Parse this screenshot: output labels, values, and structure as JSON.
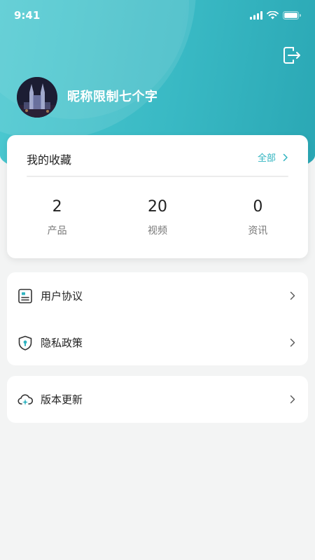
{
  "status_bar": {
    "time": "9:41"
  },
  "profile": {
    "nickname": "昵称限制七个字"
  },
  "favorites": {
    "title": "我的收藏",
    "all_label": "全部",
    "stats": [
      {
        "value": "2",
        "label": "产品"
      },
      {
        "value": "20",
        "label": "视频"
      },
      {
        "value": "0",
        "label": "资讯"
      }
    ]
  },
  "menu": {
    "group1": [
      {
        "label": "用户协议",
        "icon": "document-icon"
      },
      {
        "label": "隐私政策",
        "icon": "shield-icon"
      }
    ],
    "group2": [
      {
        "label": "版本更新",
        "icon": "cloud-update-icon"
      }
    ]
  },
  "colors": {
    "accent": "#2fb3c0",
    "header_start": "#4cc9d1",
    "header_end": "#2aa7b4",
    "background": "#f3f4f4"
  }
}
